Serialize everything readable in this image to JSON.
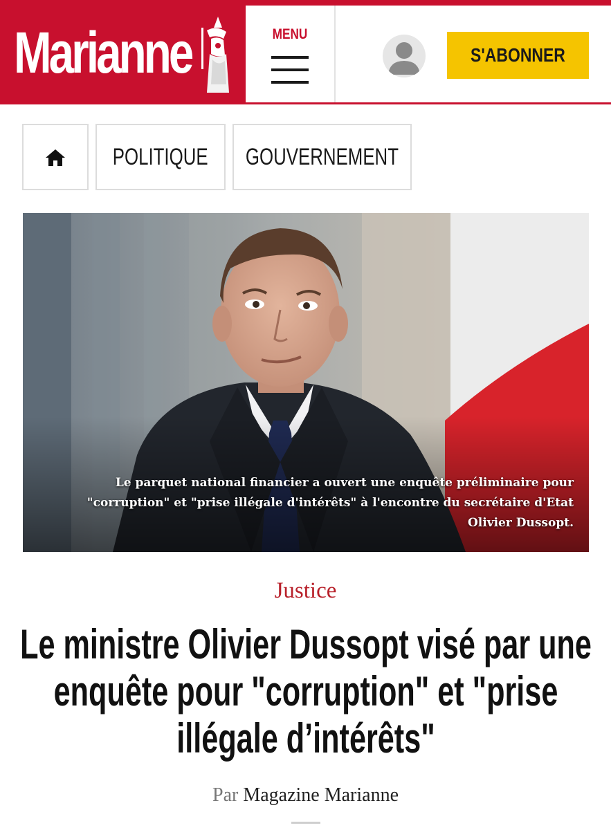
{
  "header": {
    "logo_text": "Marianne",
    "menu_label": "MENU",
    "subscribe_label": "S'ABONNER",
    "brand_color": "#c8102e",
    "subscribe_color": "#f5c400"
  },
  "breadcrumb": {
    "home_icon": "home-icon",
    "items": [
      "POLITIQUE",
      "GOUVERNEMENT"
    ]
  },
  "hero": {
    "caption": "Le parquet national financier a ouvert une enquête préliminaire pour \"corruption\" et \"prise illégale d'intérêts\" à l'encontre du secrétaire d'Etat Olivier Dussopt."
  },
  "article": {
    "rubrique": "Justice",
    "title": "Le ministre Olivier Dussopt visé par une enquête pour \"corruption\" et \"prise illégale d’intérêts\"",
    "byline_prefix": "Par",
    "author": "Magazine Marianne"
  }
}
